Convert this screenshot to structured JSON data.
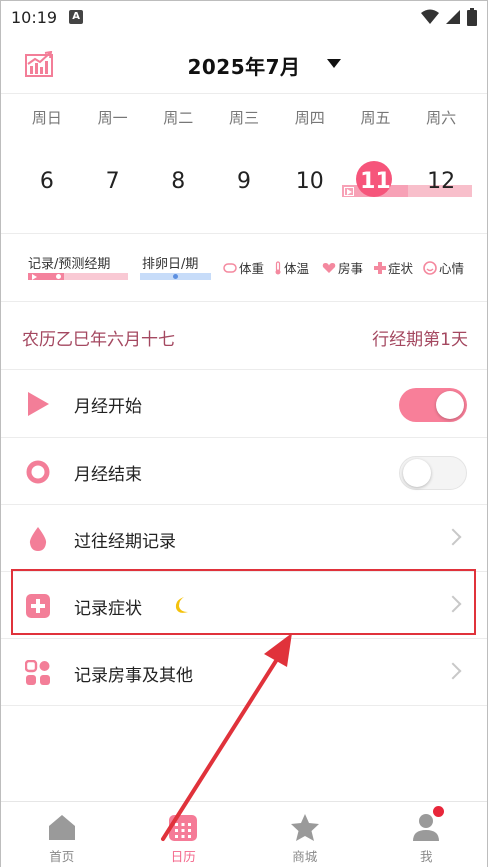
{
  "status_bar": {
    "time": "10:19",
    "badge": "A"
  },
  "header": {
    "title": "2025年7月"
  },
  "weekdays": [
    "周日",
    "周一",
    "周二",
    "周三",
    "周四",
    "周五",
    "周六"
  ],
  "dates": [
    "6",
    "7",
    "8",
    "9",
    "10",
    "11",
    "12"
  ],
  "legend": {
    "record_label": "记录/预测经期",
    "ovulation_label": "排卵日/期",
    "weight": "体重",
    "temperature": "体温",
    "intimacy": "房事",
    "symptom": "症状",
    "mood": "心情"
  },
  "lunar": {
    "left": "农历乙巳年六月十七",
    "right": "行经期第1天"
  },
  "rows": [
    {
      "label": "月经开始",
      "toggle": "on"
    },
    {
      "label": "月经结束",
      "toggle": "off"
    },
    {
      "label": "过往经期记录"
    },
    {
      "label": "记录症状"
    },
    {
      "label": "记录房事及其他"
    }
  ],
  "nav": [
    "首页",
    "日历",
    "商城",
    "我"
  ],
  "colors": {
    "accent": "#f6557b",
    "toggle_on": "#f87f99",
    "lunar_text": "#a44860",
    "highlight": "#e0323b",
    "nav_active": "#f4678b"
  }
}
